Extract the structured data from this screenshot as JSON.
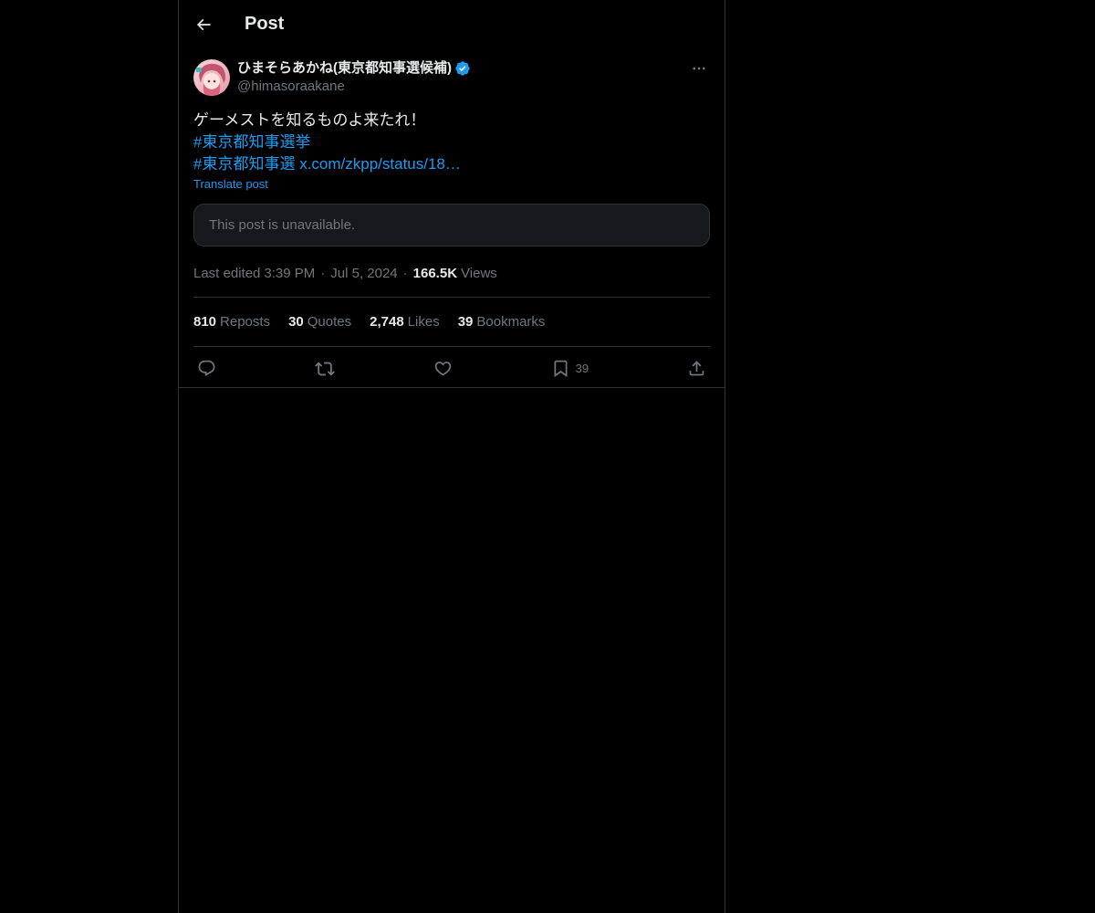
{
  "header": {
    "title": "Post",
    "back_icon": "arrow-left-icon"
  },
  "post": {
    "author": {
      "display_name": "ひまそらあかね(東京都知事選候補)",
      "handle": "@himasoraakane",
      "verified_color": "#1d9bf0"
    },
    "text_line1": "ゲーメストを知るものよ来たれ！",
    "hashtag1": "#東京都知事選挙",
    "hashtag2": "#東京都知事選",
    "link": "x.com/zkpp/status/18…",
    "translate_label": "Translate post",
    "quoted_unavailable": "This post is unavailable.",
    "meta": {
      "edited_prefix": "Last edited",
      "time": "3:39 PM",
      "date": "Jul 5, 2024",
      "views_count": "166.5K",
      "views_label": "Views"
    },
    "stats": {
      "reposts_count": "810",
      "reposts_label": "Reposts",
      "quotes_count": "30",
      "quotes_label": "Quotes",
      "likes_count": "2,748",
      "likes_label": "Likes",
      "bookmarks_count": "39",
      "bookmarks_label": "Bookmarks"
    },
    "actions": {
      "bookmark_count": "39"
    }
  },
  "colors": {
    "background": "#000000",
    "text_primary": "#e7e9ea",
    "text_secondary": "#71767b",
    "accent": "#1d9bf0",
    "border": "#2f3336"
  }
}
